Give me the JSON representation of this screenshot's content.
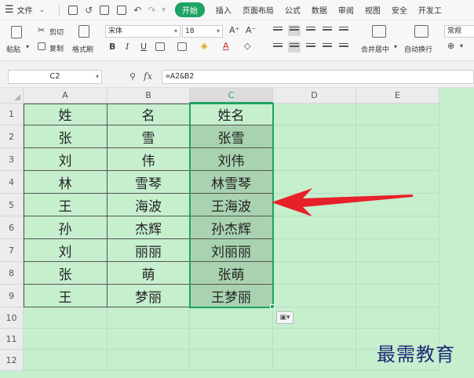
{
  "menubar": {
    "file": "文件",
    "active_tab": "开始",
    "tabs": [
      "插入",
      "页面布局",
      "公式",
      "数据",
      "审阅",
      "视图",
      "安全",
      "开发工"
    ]
  },
  "ribbon": {
    "paste": "粘贴",
    "cut": "剪切",
    "copy": "复制",
    "format_painter": "格式刷",
    "font_name": "宋体",
    "font_size": "18",
    "font_grow": "A⁺",
    "font_shrink": "A⁻",
    "bold": "B",
    "italic": "I",
    "underline": "U",
    "merge_center": "合并居中",
    "wrap_text": "自动换行",
    "number_format": "常规"
  },
  "formula_bar": {
    "cell_ref": "C2",
    "fx": "fx",
    "formula": "=A2&B2"
  },
  "grid": {
    "columns": [
      "A",
      "B",
      "C",
      "D",
      "E"
    ],
    "rows": [
      "1",
      "2",
      "3",
      "4",
      "5",
      "6",
      "7",
      "8",
      "9",
      "10",
      "11",
      "12"
    ],
    "data": [
      [
        "姓",
        "名",
        "姓名"
      ],
      [
        "张",
        "雪",
        "张雪"
      ],
      [
        "刘",
        "伟",
        "刘伟"
      ],
      [
        "林",
        "雪琴",
        "林雪琴"
      ],
      [
        "王",
        "海波",
        "王海波"
      ],
      [
        "孙",
        "杰辉",
        "孙杰辉"
      ],
      [
        "刘",
        "丽丽",
        "刘丽丽"
      ],
      [
        "张",
        "萌",
        "张萌"
      ],
      [
        "王",
        "梦丽",
        "王梦丽"
      ]
    ],
    "paste_options": "▣▾"
  },
  "watermark": "最需教育",
  "colors": {
    "accent": "#1fa463",
    "sheet_fill": "#c6efce",
    "arrow": "#e8202a"
  }
}
